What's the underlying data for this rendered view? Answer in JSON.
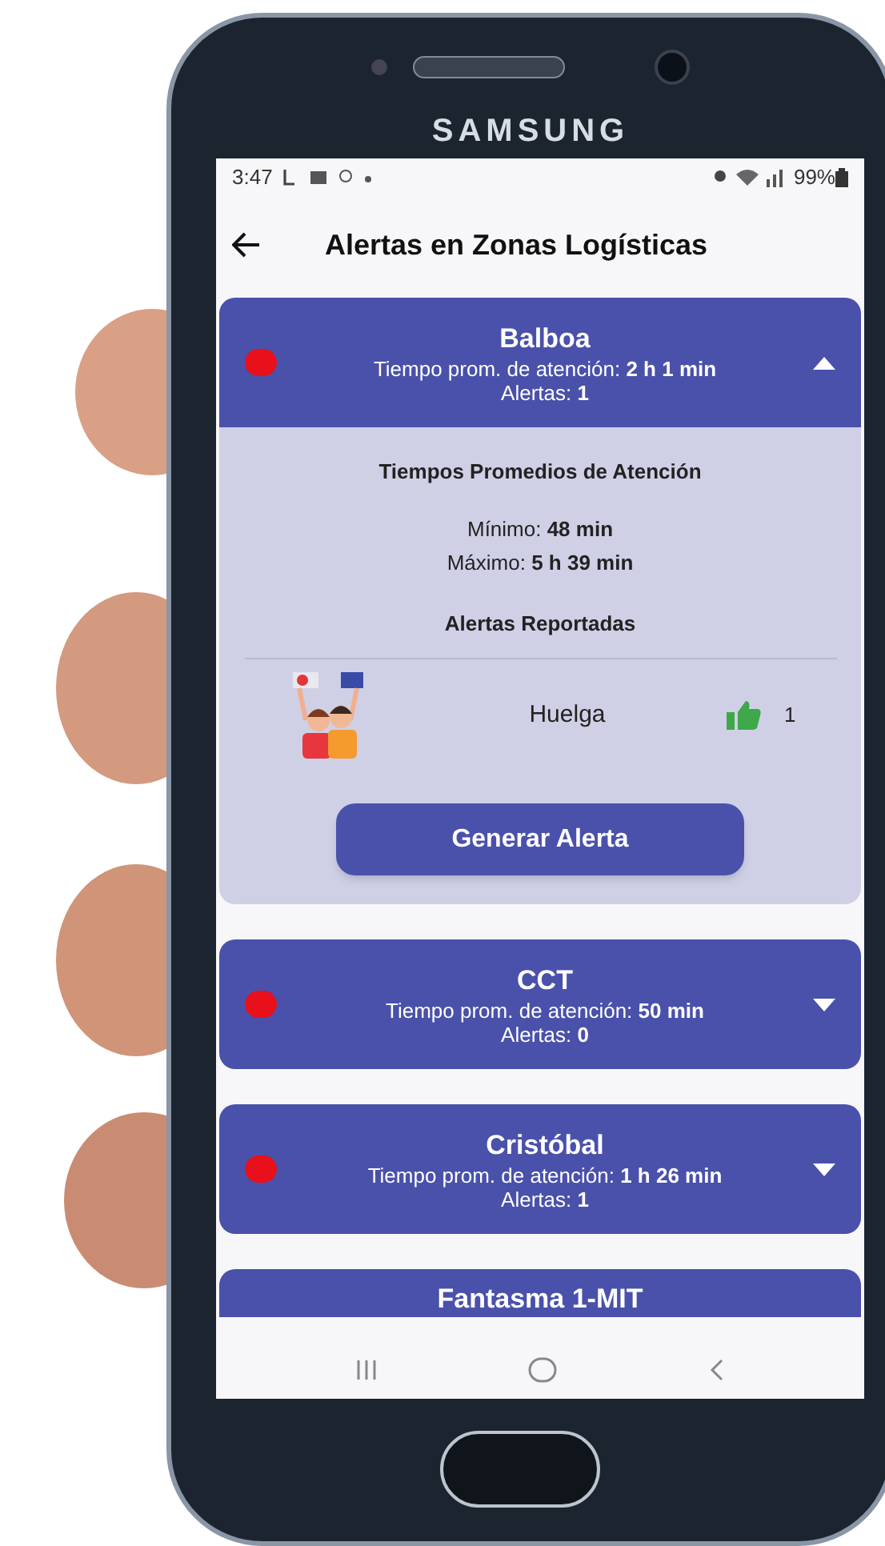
{
  "device": {
    "brand": "SAMSUNG"
  },
  "status_bar": {
    "time": "3:47",
    "battery": "99%"
  },
  "header": {
    "title": "Alertas en Zonas Logísticas"
  },
  "zones": [
    {
      "name": "Balboa",
      "color": "#e8101a",
      "expanded": true,
      "avg_time": "Tiempo prom. de atención: **2 h 1 min**",
      "alerts": "Alertas: **1**",
      "details": {
        "times_title": "Tiempos Promedios de Atención",
        "minimum": "Mínimo: **48 min**",
        "maximum": "Máximo: **5 h 39 min**",
        "alerts_title": "Alertas Reportadas",
        "alert_items": [
          {
            "label": "Huelga",
            "count": "1"
          }
        ],
        "button": "Generar Alerta"
      }
    },
    {
      "name": "CCT",
      "color": "#e8101a",
      "expanded": false,
      "avg_time": "Tiempo prom. de atención: **50 min**",
      "alerts": "Alertas: **0**"
    },
    {
      "name": "Cristóbal",
      "color": "#e8101a",
      "expanded": false,
      "avg_time": "Tiempo prom. de atención: **1 h 26 min**",
      "alerts": "Alertas: **1**"
    },
    {
      "name": "Fantasma 1-MIT"
    }
  ]
}
